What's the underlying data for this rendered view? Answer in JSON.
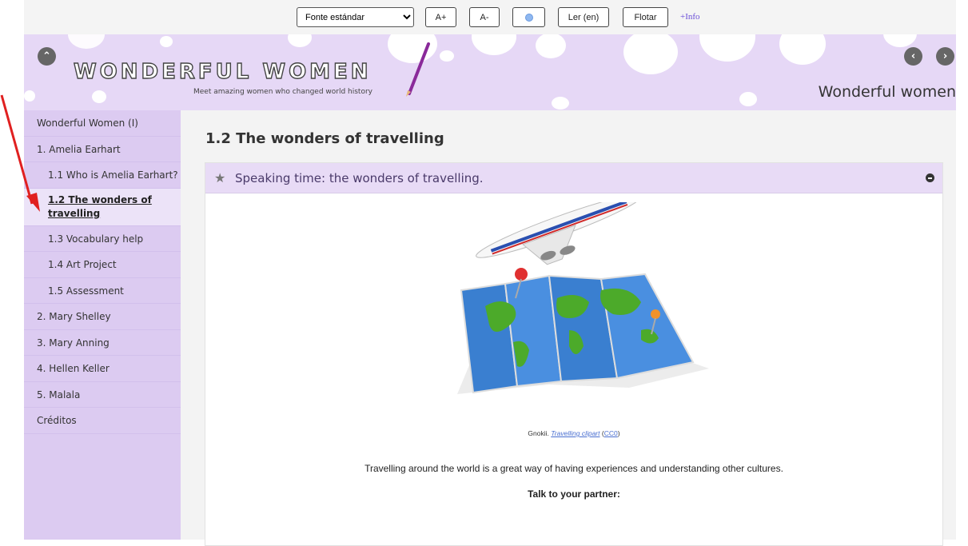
{
  "toolbar": {
    "font_select_value": "Fonte estándar",
    "increase_label": "A+",
    "decrease_label": "A-",
    "read_label": "Ler (en)",
    "float_label": "Flotar",
    "info_label": "+Info"
  },
  "header": {
    "logo_title": "WONDERFUL WOMEN",
    "logo_subtitle": "Meet amazing women who changed world history",
    "site_title": "Wonderful women"
  },
  "sidebar": {
    "items": [
      {
        "label": "Wonderful Women (I)"
      },
      {
        "label": "1. Amelia Earhart"
      },
      {
        "label": "1.1 Who is Amelia Earhart?"
      },
      {
        "label": "1.2 The wonders of travelling"
      },
      {
        "label": "1.3 Vocabulary help"
      },
      {
        "label": "1.4 Art Project"
      },
      {
        "label": "1.5 Assessment"
      },
      {
        "label": "2. Mary Shelley"
      },
      {
        "label": "3. Mary Anning"
      },
      {
        "label": "4. Hellen Keller"
      },
      {
        "label": "5. Malala"
      },
      {
        "label": "Créditos"
      }
    ]
  },
  "main": {
    "page_title": "1.2 The wonders of travelling",
    "card_title": "Speaking time: the wonders of travelling.",
    "caption_author": "Gnokii.",
    "caption_link": "Travelling clipart",
    "caption_license": "CC0",
    "paragraph": "Travelling around the world is a great way of having experiences and understanding other cultures.",
    "bold_line": "Talk to your partner:"
  },
  "colors": {
    "accent": "#e6d8f6",
    "sidebar": "#dccbf1",
    "arrow": "#e02020"
  }
}
